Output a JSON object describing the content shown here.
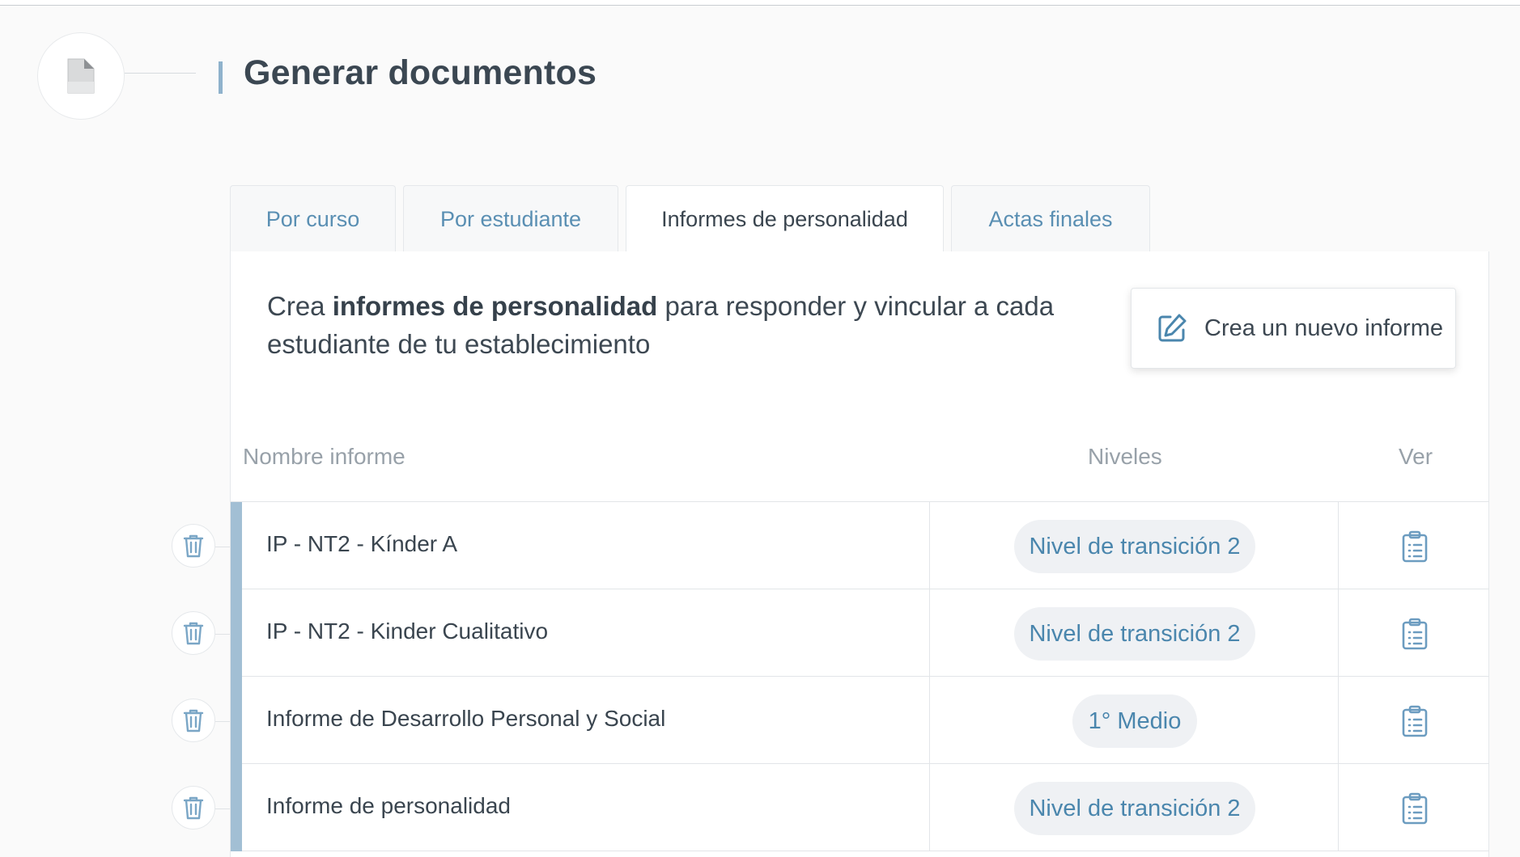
{
  "header": {
    "title": "Generar documentos",
    "icon": "document-icon"
  },
  "tabs": [
    {
      "label": "Por curso",
      "active": false
    },
    {
      "label": "Por estudiante",
      "active": false
    },
    {
      "label": "Informes de personalidad",
      "active": true
    },
    {
      "label": "Actas finales",
      "active": false
    }
  ],
  "intro": {
    "prefix": "Crea ",
    "bold": "informes de personalidad",
    "suffix": " para responder y vincular a cada estudiante de tu establecimiento"
  },
  "new_report_button": {
    "label": "Crea un nuevo informe",
    "icon": "edit-icon"
  },
  "table": {
    "columns": {
      "name": "Nombre informe",
      "levels": "Niveles",
      "view": "Ver"
    },
    "rows": [
      {
        "name": "IP - NT2 - Kínder A",
        "level": "Nivel de transición 2"
      },
      {
        "name": "IP - NT2 - Kinder Cualitativo",
        "level": "Nivel de transición 2"
      },
      {
        "name": "Informe de Desarrollo Personal y Social",
        "level": "1° Medio"
      },
      {
        "name": "Informe de personalidad",
        "level": "Nivel de transición 2"
      }
    ]
  },
  "colors": {
    "accent_bar": "#a2bfd4",
    "link_blue": "#5a8fb3",
    "pill_bg": "#eff1f4",
    "pill_text": "#4a86ad"
  }
}
